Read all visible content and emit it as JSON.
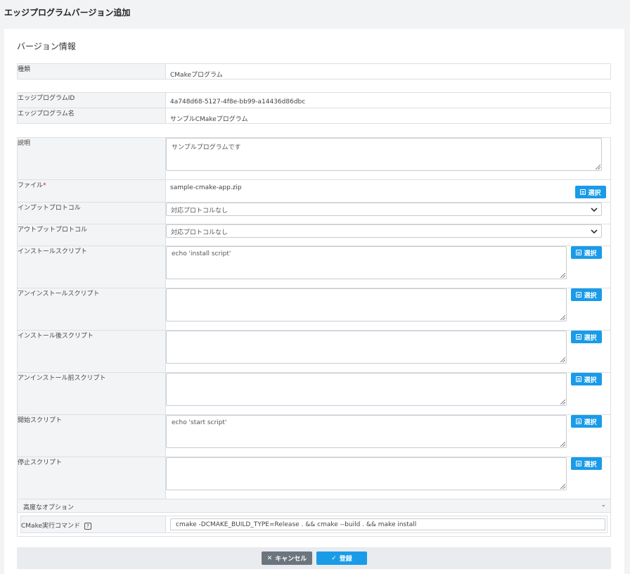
{
  "page": {
    "title": "エッジプログラムバージョン追加"
  },
  "section": {
    "title": "バージョン情報"
  },
  "type_row": {
    "label": "種類",
    "value": "CMakeプログラム"
  },
  "id_row": {
    "label": "エッジプログラムID",
    "value": "4a748d68-5127-4f8e-bb99-a14436d86dbc"
  },
  "name_row": {
    "label": "エッジプログラム名",
    "value": "サンプルCMakeプログラム"
  },
  "description": {
    "label": "説明",
    "value": "サンプルプログラムです"
  },
  "file": {
    "label": "ファイル",
    "required_mark": "*",
    "value": "sample-cmake-app.zip"
  },
  "select_button_label": "選択",
  "input_protocol": {
    "label": "インプットプロトコル",
    "value": "対応プロトコルなし"
  },
  "output_protocol": {
    "label": "アウトプットプロトコル",
    "value": "対応プロトコルなし"
  },
  "scripts": [
    {
      "label": "インストールスクリプト",
      "value": "echo 'install script'"
    },
    {
      "label": "アンインストールスクリプト",
      "value": ""
    },
    {
      "label": "インストール後スクリプト",
      "value": ""
    },
    {
      "label": "アンインストール前スクリプト",
      "value": ""
    },
    {
      "label": "開始スクリプト",
      "value": "echo 'start script'"
    },
    {
      "label": "停止スクリプト",
      "value": ""
    }
  ],
  "advanced": {
    "label": "高度なオプション"
  },
  "cmake_command": {
    "label": "CMake実行コマンド",
    "value": "cmake -DCMAKE_BUILD_TYPE=Release . && cmake --build . && make install"
  },
  "footer": {
    "cancel_label": "キャンセル",
    "submit_label": "登録"
  },
  "colors": {
    "primary": "#1a9be8",
    "secondary": "#6c757d",
    "required": "#e02020"
  }
}
